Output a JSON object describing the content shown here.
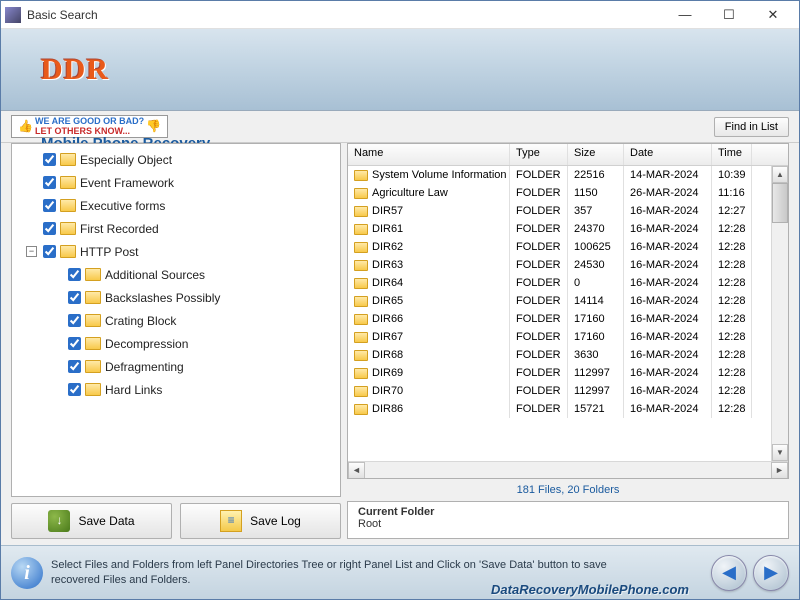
{
  "window": {
    "title": "Basic Search"
  },
  "header": {
    "logo": "DDR",
    "subtitle": "Mobile Phone Recovery"
  },
  "feedback": {
    "line1": "WE ARE GOOD OR BAD?",
    "line2": "LET OTHERS KNOW..."
  },
  "toolbar": {
    "find_in_list": "Find in List"
  },
  "tree": {
    "items": [
      {
        "label": "Especially Object",
        "level": 0,
        "checked": true
      },
      {
        "label": "Event Framework",
        "level": 0,
        "checked": true
      },
      {
        "label": "Executive forms",
        "level": 0,
        "checked": true
      },
      {
        "label": "First Recorded",
        "level": 0,
        "checked": true
      },
      {
        "label": "HTTP Post",
        "level": 0,
        "checked": true,
        "expanded": true
      },
      {
        "label": "Additional Sources",
        "level": 1,
        "checked": true
      },
      {
        "label": "Backslashes Possibly",
        "level": 1,
        "checked": true
      },
      {
        "label": "Crating Block",
        "level": 1,
        "checked": true
      },
      {
        "label": "Decompression",
        "level": 1,
        "checked": true
      },
      {
        "label": "Defragmenting",
        "level": 1,
        "checked": true
      },
      {
        "label": "Hard Links",
        "level": 1,
        "checked": true
      }
    ]
  },
  "buttons": {
    "save_data": "Save Data",
    "save_log": "Save Log"
  },
  "file_list": {
    "columns": {
      "name": "Name",
      "type": "Type",
      "size": "Size",
      "date": "Date",
      "time": "Time"
    },
    "rows": [
      {
        "name": "System Volume Information",
        "type": "FOLDER",
        "size": "22516",
        "date": "14-MAR-2024",
        "time": "10:39"
      },
      {
        "name": "Agriculture Law",
        "type": "FOLDER",
        "size": "1150",
        "date": "26-MAR-2024",
        "time": "11:16"
      },
      {
        "name": "DIR57",
        "type": "FOLDER",
        "size": "357",
        "date": "16-MAR-2024",
        "time": "12:27"
      },
      {
        "name": "DIR61",
        "type": "FOLDER",
        "size": "24370",
        "date": "16-MAR-2024",
        "time": "12:28"
      },
      {
        "name": "DIR62",
        "type": "FOLDER",
        "size": "100625",
        "date": "16-MAR-2024",
        "time": "12:28"
      },
      {
        "name": "DIR63",
        "type": "FOLDER",
        "size": "24530",
        "date": "16-MAR-2024",
        "time": "12:28"
      },
      {
        "name": "DIR64",
        "type": "FOLDER",
        "size": "0",
        "date": "16-MAR-2024",
        "time": "12:28"
      },
      {
        "name": "DIR65",
        "type": "FOLDER",
        "size": "14114",
        "date": "16-MAR-2024",
        "time": "12:28"
      },
      {
        "name": "DIR66",
        "type": "FOLDER",
        "size": "17160",
        "date": "16-MAR-2024",
        "time": "12:28"
      },
      {
        "name": "DIR67",
        "type": "FOLDER",
        "size": "17160",
        "date": "16-MAR-2024",
        "time": "12:28"
      },
      {
        "name": "DIR68",
        "type": "FOLDER",
        "size": "3630",
        "date": "16-MAR-2024",
        "time": "12:28"
      },
      {
        "name": "DIR69",
        "type": "FOLDER",
        "size": "112997",
        "date": "16-MAR-2024",
        "time": "12:28"
      },
      {
        "name": "DIR70",
        "type": "FOLDER",
        "size": "112997",
        "date": "16-MAR-2024",
        "time": "12:28"
      },
      {
        "name": "DIR86",
        "type": "FOLDER",
        "size": "15721",
        "date": "16-MAR-2024",
        "time": "12:28"
      }
    ]
  },
  "status": {
    "count": "181 Files, 20 Folders"
  },
  "current_folder": {
    "label": "Current Folder",
    "value": "Root"
  },
  "footer": {
    "hint": "Select Files and Folders from left Panel Directories Tree or right Panel List and Click on 'Save Data' button to save recovered Files and Folders.",
    "watermark": "DataRecoveryMobilePhone.com"
  }
}
